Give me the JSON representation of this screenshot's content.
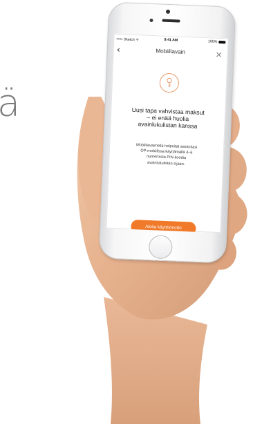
{
  "background": {
    "partial_letter": "ä"
  },
  "status_bar": {
    "carrier": "••••• Sketch ᯤ",
    "time": "9:41 AM",
    "battery": "100%"
  },
  "navbar": {
    "back_icon": "chevron-left-icon",
    "title": "Mobiiliavain",
    "close_icon": "close-icon"
  },
  "content": {
    "key_icon": "key-icon",
    "headline_lines": [
      "Uusi tapa vahvistaa maksut",
      "– ei enää huolia",
      "avainlukulistan kanssa"
    ],
    "body_lines": [
      "Mobiiliavaimella helpoitat asiointiasi",
      "OP-mobiilissa käyttämällä 4–6",
      "numeroista PIN-koodia",
      "avainlukulistan sijaan."
    ]
  },
  "cta": {
    "label": "Aloita käyttöönotto"
  },
  "colors": {
    "accent": "#f07a2a",
    "key_outline": "#e79a6a"
  }
}
